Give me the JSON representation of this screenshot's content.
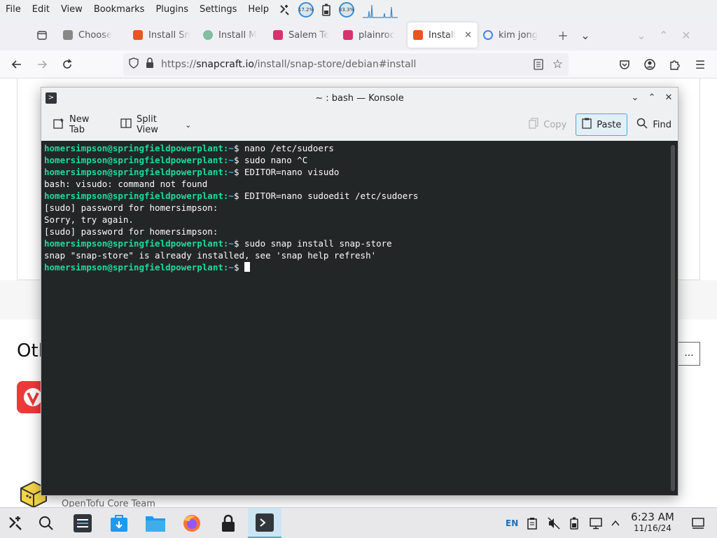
{
  "menubar": {
    "items": [
      "File",
      "Edit",
      "View",
      "Bookmarks",
      "Plugins",
      "Settings",
      "Help"
    ],
    "cpu_percent": "17.2%",
    "mem_percent": "33.3%"
  },
  "browser": {
    "tabs": [
      {
        "label": "Choose",
        "color": "#888888"
      },
      {
        "label": "Install Sn",
        "color": "#e95420"
      },
      {
        "label": "Install M",
        "color": "#82bea0"
      },
      {
        "label": "Salem Te",
        "color": "#d6336c"
      },
      {
        "label": "plainroc",
        "color": "#d6336c"
      },
      {
        "label": "Install",
        "color": "#e95420"
      },
      {
        "label": "kim jong",
        "color": "#4285f4"
      }
    ],
    "url_prefix": "https://",
    "url_domain": "snapcraft.io",
    "url_path": "/install/snap-store/debian#install"
  },
  "page": {
    "heading": "Otl",
    "more_button": "...",
    "team_label": "OpenTofu Core Team"
  },
  "konsole": {
    "title": "~ : bash — Konsole",
    "toolbar": {
      "new_tab": "New Tab",
      "split_view": "Split View",
      "copy": "Copy",
      "paste": "Paste",
      "find": "Find"
    },
    "prompt_user": "homersimpson@springfieldpowerplant",
    "prompt_path": "~",
    "lines": [
      {
        "prompt": true,
        "text": " nano /etc/sudoers"
      },
      {
        "prompt": true,
        "text": " sudo nano ^C"
      },
      {
        "prompt": true,
        "text": " EDITOR=nano visudo"
      },
      {
        "prompt": false,
        "text": "bash: visudo: command not found"
      },
      {
        "prompt": true,
        "text": " EDITOR=nano sudoedit /etc/sudoers"
      },
      {
        "prompt": false,
        "text": "[sudo] password for homersimpson:"
      },
      {
        "prompt": false,
        "text": "Sorry, try again."
      },
      {
        "prompt": false,
        "text": "[sudo] password for homersimpson:"
      },
      {
        "prompt": true,
        "text": " sudo snap install snap-store"
      },
      {
        "prompt": false,
        "text": "snap \"snap-store\" is already installed, see 'snap help refresh'"
      },
      {
        "prompt": true,
        "text": " ",
        "cursor": true
      }
    ]
  },
  "taskbar": {
    "language": "EN",
    "time": "6:23 AM",
    "date": "11/16/24"
  }
}
